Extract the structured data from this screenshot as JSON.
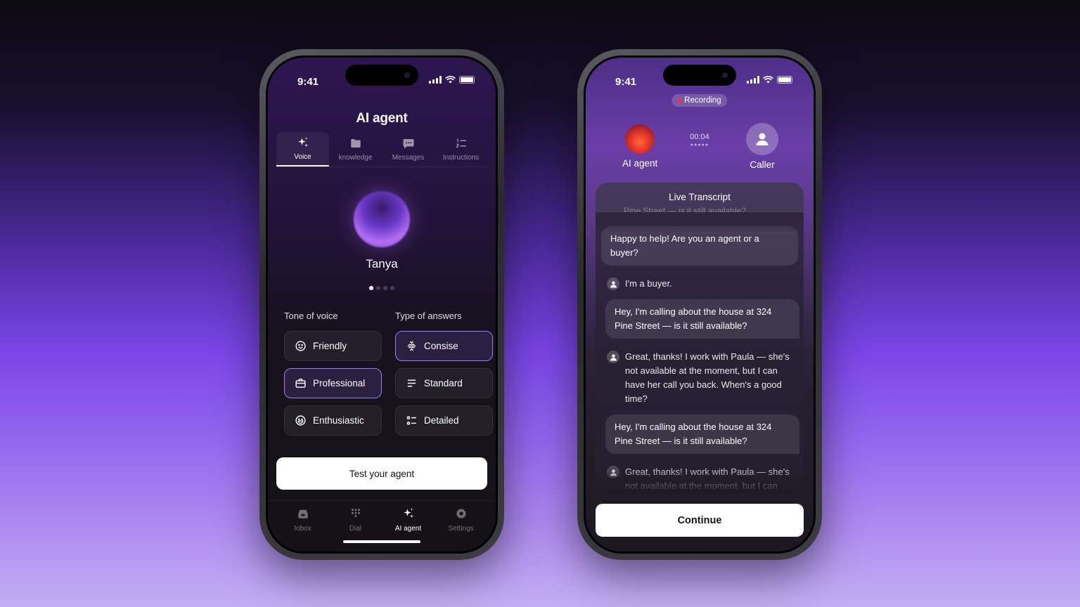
{
  "left_phone": {
    "status": {
      "time": "9:41"
    },
    "title": "AI agent",
    "tabs": [
      {
        "label": "Voice",
        "icon": "sparkle-icon",
        "active": true
      },
      {
        "label": "knowledge",
        "icon": "folder-icon",
        "active": false
      },
      {
        "label": "Messages",
        "icon": "message-icon",
        "active": false
      },
      {
        "label": "Instructions",
        "icon": "list-icon",
        "active": false
      }
    ],
    "agent_name": "Tanya",
    "tone_label": "Tone of voice",
    "answers_label": "Type of answers",
    "tone_options": [
      {
        "label": "Friendly",
        "icon": "smile-icon",
        "selected": false
      },
      {
        "label": "Professional",
        "icon": "briefcase-icon",
        "selected": true
      },
      {
        "label": "Enthusiastic",
        "icon": "grin-icon",
        "selected": false
      }
    ],
    "answer_options": [
      {
        "label": "Consise",
        "icon": "compress-icon",
        "selected": true
      },
      {
        "label": "Standard",
        "icon": "lines-icon",
        "selected": false
      },
      {
        "label": "Detailed",
        "icon": "detailed-list-icon",
        "selected": false
      }
    ],
    "test_button": "Test your agent",
    "tabbar": [
      {
        "label": "Inbox",
        "icon": "inbox-icon",
        "active": false
      },
      {
        "label": "Dial",
        "icon": "dialpad-icon",
        "active": false
      },
      {
        "label": "AI agent",
        "icon": "sparkle-icon",
        "active": true
      },
      {
        "label": "Settings",
        "icon": "gear-icon",
        "active": false
      }
    ]
  },
  "right_phone": {
    "status": {
      "time": "9:41"
    },
    "recording": "Recording",
    "timer": "00:04",
    "agent_label": "AI agent",
    "caller_label": "Caller",
    "transcript_title": "Live Transcript",
    "clipped_line": "Pine Street — is it still available?",
    "messages": [
      {
        "role": "agent",
        "text": "Happy to help! Are you an agent or a buyer?"
      },
      {
        "role": "caller",
        "text": "I'm a buyer."
      },
      {
        "role": "agent",
        "text": "Hey, I'm calling about the house at 324 Pine Street — is it still available?"
      },
      {
        "role": "caller",
        "text": "Great, thanks! I work with Paula — she's not available at the moment, but I can have her call you back. When's a good time?"
      },
      {
        "role": "agent",
        "text": "Hey, I'm calling about the house at 324 Pine Street — is it still available?"
      },
      {
        "role": "caller",
        "text": "Great, thanks! I work with Paula — she's not available at the moment, but I can have her call you back. When's a good time?"
      }
    ],
    "continue_button": "Continue"
  }
}
